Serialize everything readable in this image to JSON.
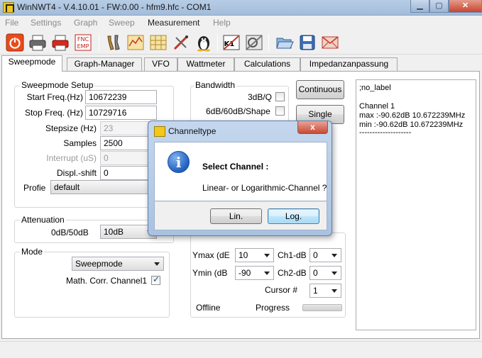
{
  "window": {
    "title": "WinNWT4 - V.4.10.01 - FW:0.00 - hfm9.hfc - COM1"
  },
  "menu": [
    "File",
    "Settings",
    "Graph",
    "Sweep",
    "Measurement",
    "Help"
  ],
  "toolbar": {
    "icons": [
      "power-icon",
      "printer-icon",
      "print-pdf-icon",
      "func-emp-icon",
      "tools-icon",
      "chart-icon",
      "chart-grid-icon",
      "probe-icon",
      "linux-penguin-icon",
      "k1-calibration-icon",
      "calibration-icon",
      "open-folder-icon",
      "save-disk-icon",
      "envelope-icon"
    ],
    "func_label": "FNC",
    "emp_label": "EMP",
    "k1_label": "K1"
  },
  "tabs": [
    "Sweepmode",
    "Graph-Manager",
    "VFO",
    "Wattmeter",
    "Calculations",
    "Impedanzanpassung"
  ],
  "sweepmode_setup": {
    "title": "Sweepmode Setup",
    "start_label": "Start Freq.(Hz)",
    "start_value": "10672239",
    "stop_label": "Stop Freq. (Hz)",
    "stop_value": "10729716",
    "stepsize_label": "Stepsize (Hz)",
    "stepsize_value": "23",
    "samples_label": "Samples",
    "samples_value": "2500",
    "interrupt_label": "Interrupt (uS)",
    "interrupt_value": "0",
    "displ_label": "Displ.-shift",
    "displ_value": "0",
    "profile_label": "Profie",
    "profile_value": "default"
  },
  "attenuation": {
    "title": "Attenuation",
    "label": "0dB/50dB",
    "value": "10dB"
  },
  "mode": {
    "title": "Mode",
    "value": "Sweepmode",
    "math_label": "Math. Corr. Channel1",
    "math_checked": true
  },
  "bandwidth": {
    "title": "Bandwidth",
    "q3db_label": "3dB/Q",
    "shape_label": "6dB/60dB/Shape"
  },
  "buttons": {
    "continuous": "Continuous",
    "single": "Single"
  },
  "levels": {
    "ymax_label": "Ymax (dE",
    "ymax_value": "10",
    "ymin_label": "Ymin (dB",
    "ymin_value": "-90",
    "ch1_label": "Ch1-dB",
    "ch1_value": "0",
    "ch2_label": "Ch2-dB",
    "ch2_value": "0",
    "cursor_label": "Cursor #",
    "cursor_value": "1",
    "offline_label": "Offline",
    "progress_label": "Progress",
    "progress_fraction": 0
  },
  "memo": {
    "lines": [
      ";no_label",
      "",
      "Channel 1",
      "max :-90.62dB 10.672239MHz",
      "min :-90.62dB 10.672239MHz",
      "--------------------"
    ]
  },
  "dialog": {
    "title": "Channeltype",
    "heading": "Select Channel :",
    "message": "Linear- or Logarithmic-Channel ?",
    "lin_button": "Lin.",
    "log_button": "Log.",
    "close_glyph": "x"
  }
}
